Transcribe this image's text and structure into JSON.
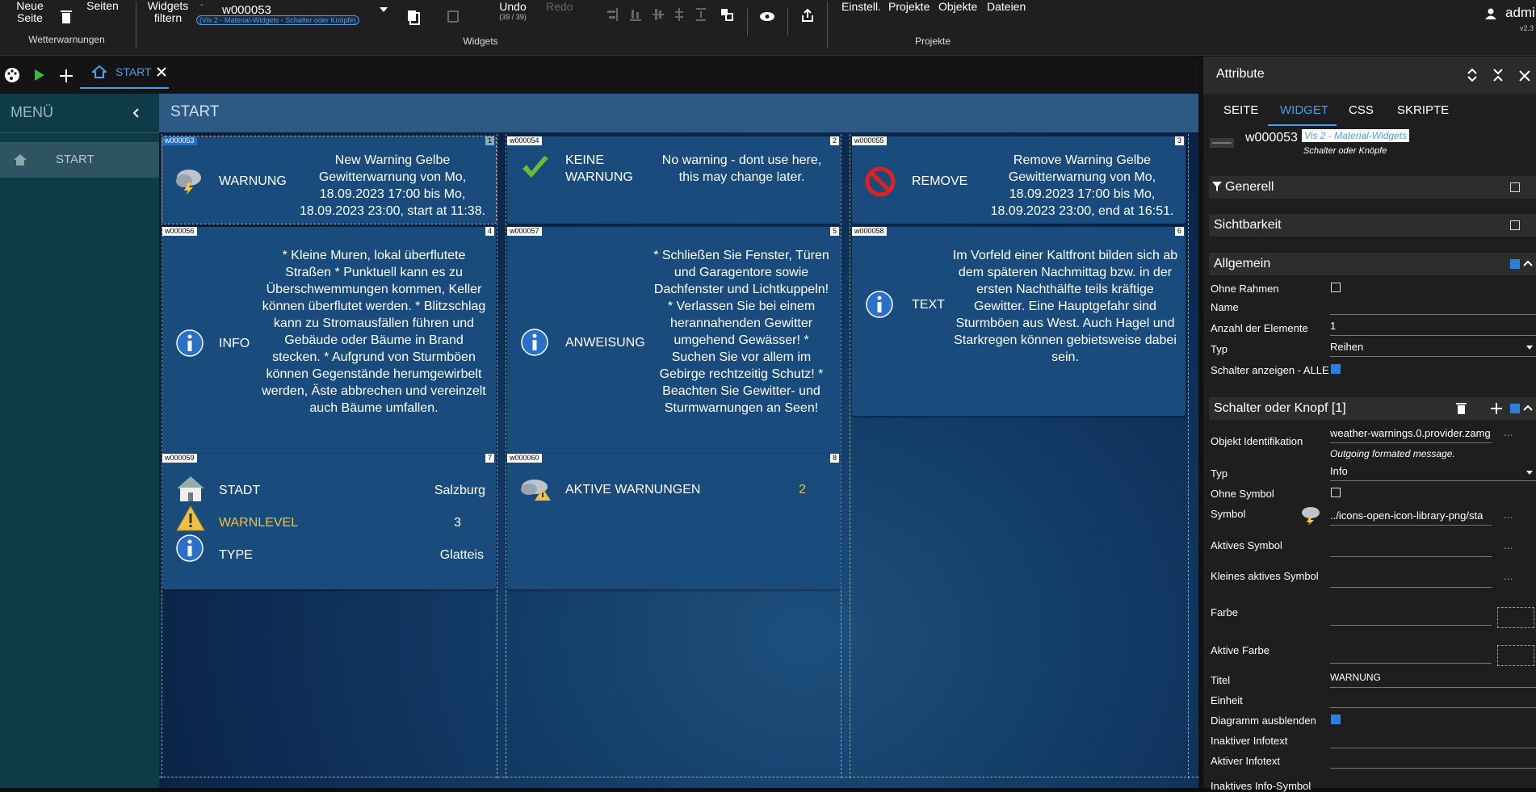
{
  "toolbar": {
    "new_page": "Neue Seite",
    "pages": "Seiten",
    "page_group": "Wetterwarnungen",
    "widgets_filter": "Widgets filtern",
    "widget_dash": "-",
    "widget_id": "w000053",
    "widget_type": "(Vis 2 - Material-Widgets - Schalter oder Knöpfe)",
    "undo": "Undo",
    "undo_count": "(39 / 39)",
    "redo": "Redo",
    "widgets_group": "Widgets",
    "settings": "Einstell.",
    "projects": "Projekte",
    "objects": "Objekte",
    "files": "Dateien",
    "projects_group": "Projekte",
    "user": "admin",
    "version": "v2.3"
  },
  "tabs": {
    "active": "START"
  },
  "menu": {
    "title": "MENÜ",
    "items": [
      {
        "label": "START"
      }
    ]
  },
  "canvas": {
    "title": "START"
  },
  "widgets": {
    "w53": {
      "id": "w000053",
      "num": "1",
      "label": "WARNUNG",
      "text": "New Warning Gelbe Gewitterwarnung von Mo, 18.09.2023 17:00 bis Mo, 18.09.2023 23:00, start at 11:38."
    },
    "w54": {
      "id": "w000054",
      "num": "2",
      "label": "KEINE WARNUNG",
      "text": "No warning - dont use here, this may change later."
    },
    "w55": {
      "id": "w000055",
      "num": "3",
      "label": "REMOVE",
      "text": "Remove Warning Gelbe Gewitterwarnung von Mo, 18.09.2023 17:00 bis Mo, 18.09.2023 23:00, end at 16:51."
    },
    "w56": {
      "id": "w000056",
      "num": "4",
      "label": "INFO",
      "text": "* Kleine Muren, lokal überflutete Straßen * Punktuell kann es zu Überschwemmungen kommen, Keller können überflutet werden. * Blitzschlag kann zu Stromausfällen führen und Gebäude oder Bäume in Brand stecken. * Aufgrund von Sturmböen können Gegenstände herumgewirbelt werden, Äste abbrechen und vereinzelt auch Bäume umfallen."
    },
    "w57": {
      "id": "w000057",
      "num": "5",
      "label": "ANWEISUNG",
      "text": "* Schließen Sie Fenster, Türen und Garagentore sowie Dachfenster und Lichtkuppeln! * Verlassen Sie bei einem herannahenden Gewitter umgehend Gewässer! * Suchen Sie vor allem im Gebirge rechtzeitig Schutz! * Beachten Sie Gewitter- und Sturmwarnungen an Seen!"
    },
    "w58": {
      "id": "w000058",
      "num": "6",
      "label": "TEXT",
      "text": "Im Vorfeld einer Kaltfront bilden sich ab dem späteren Nachmittag bzw. in der ersten Nachthälfte teils kräftige Gewitter. Eine Hauptgefahr sind Sturmböen aus West. Auch Hagel und Starkregen können gebietsweise dabei sein."
    },
    "w59": {
      "id": "w000059",
      "num": "7",
      "rows": [
        {
          "label": "STADT",
          "value": "Salzburg"
        },
        {
          "label": "WARNLEVEL",
          "value": "3"
        },
        {
          "label": "TYPE",
          "value": "Glatteis"
        }
      ]
    },
    "w60": {
      "id": "w000060",
      "num": "8",
      "label": "AKTIVE WARNUNGEN",
      "value": "2"
    }
  },
  "panel": {
    "title": "Attribute",
    "tabs": [
      "SEITE",
      "WIDGET",
      "CSS",
      "SKRIPTE"
    ],
    "widget_id": "w000053",
    "widget_set": "Vis 2 - Material-Widgets",
    "widget_name": "Schalter oder Knöpfe",
    "sections": {
      "generell": "Generell",
      "sichtbarkeit": "Sichtbarkeit",
      "allgemein": "Allgemein",
      "schalter": "Schalter oder Knopf [1]"
    },
    "allgemein": {
      "ohne_rahmen": "Ohne Rahmen",
      "name": "Name",
      "anzahl": "Anzahl der Elemente",
      "anzahl_val": "1",
      "typ": "Typ",
      "typ_val": "Reihen",
      "schalter_anz": "Schalter anzeigen - ALLE"
    },
    "schalter": {
      "obj_id": "Objekt Identifikation",
      "obj_val": "weather-warnings.0.provider.zamg",
      "obj_desc": "Outgoing formated message.",
      "typ": "Typ",
      "typ_val": "Info",
      "ohne_symbol": "Ohne Symbol",
      "symbol": "Symbol",
      "symbol_val": "../icons-open-icon-library-png/sta",
      "aktives_symbol": "Aktives Symbol",
      "kleines": "Kleines aktives Symbol",
      "farbe": "Farbe",
      "aktive_farbe": "Aktive Farbe",
      "titel": "Titel",
      "titel_val": "WARNUNG",
      "einheit": "Einheit",
      "diagramm": "Diagramm ausblenden",
      "inaktiver": "Inaktiver Infotext",
      "aktiver": "Aktiver Infotext",
      "inaktives_symbol": "Inaktives Info-Symbol"
    }
  },
  "colors": {
    "accent": "#2a7fe0",
    "warnlevel": "#f0c040",
    "card": "#194c7c"
  }
}
